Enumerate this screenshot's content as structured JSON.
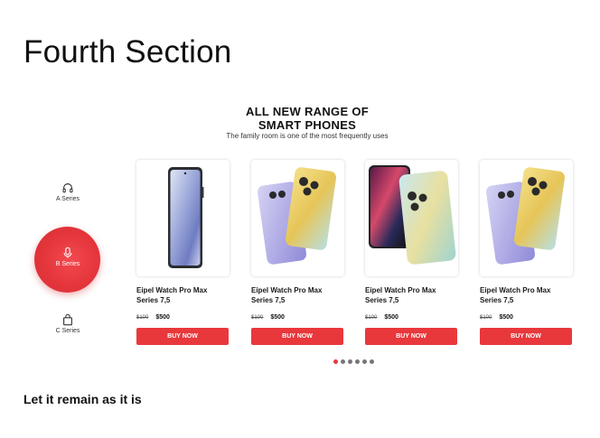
{
  "page": {
    "heading": "Fourth Section",
    "footnote": "Let it remain as it is"
  },
  "promo": {
    "title_line1": "ALL NEW RANGE OF",
    "title_line2": "SMART PHONES",
    "subtitle": "The family room is one of the most frequently uses"
  },
  "series": [
    {
      "label": "A Series",
      "icon": "headphones-icon",
      "active": false
    },
    {
      "label": "B Series",
      "icon": "microphone-icon",
      "active": true
    },
    {
      "label": "C Series",
      "icon": "shopping-bag-icon",
      "active": false
    }
  ],
  "products": [
    {
      "title": "Eipel Watch Pro Max Series 7,5",
      "old_price": "$100",
      "price": "$500",
      "button": "BUY NOW"
    },
    {
      "title": "Eipel Watch Pro Max Series 7,5",
      "old_price": "$100",
      "price": "$500",
      "button": "BUY NOW"
    },
    {
      "title": "Eipel Watch Pro Max Series 7,5",
      "old_price": "$100",
      "price": "$500",
      "button": "BUY NOW"
    },
    {
      "title": "Eipel Watch Pro Max Series 7,5",
      "old_price": "$100",
      "price": "$500",
      "button": "BUY NOW"
    }
  ],
  "carousel": {
    "dot_count": 6,
    "active_index": 0
  },
  "colors": {
    "accent": "#e8383c",
    "text": "#111111",
    "dot": "#777777"
  }
}
